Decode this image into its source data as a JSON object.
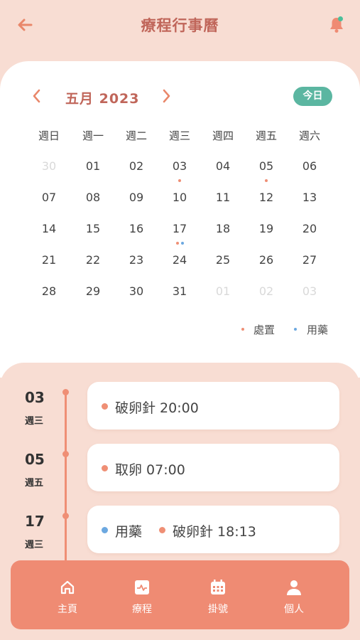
{
  "header": {
    "title": "療程行事曆",
    "back_icon": "arrow-left-icon",
    "bell_icon": "bell-icon"
  },
  "calendar": {
    "month_label": "五月 2023",
    "today_label": "今日",
    "weekdays": [
      "週日",
      "週一",
      "週二",
      "週三",
      "週四",
      "週五",
      "週六"
    ],
    "weeks": [
      [
        "30",
        "01",
        "02",
        "03",
        "04",
        "05",
        "06"
      ],
      [
        "07",
        "08",
        "09",
        "10",
        "11",
        "12",
        "13"
      ],
      [
        "14",
        "15",
        "16",
        "17",
        "18",
        "19",
        "20"
      ],
      [
        "21",
        "22",
        "23",
        "24",
        "25",
        "26",
        "27"
      ],
      [
        "28",
        "29",
        "30",
        "31",
        "01",
        "02",
        "03"
      ]
    ],
    "muted_days": [
      "0-0",
      "4-4",
      "4-5",
      "4-6"
    ],
    "markers": {
      "0-3": [
        "treatment"
      ],
      "0-5": [
        "treatment"
      ],
      "2-3": [
        "treatment",
        "medication"
      ]
    },
    "legend": {
      "treatment": "處置",
      "medication": "用藥"
    },
    "colors": {
      "treatment": "#ef8f75",
      "medication": "#6ca8e0"
    }
  },
  "events": [
    {
      "date": "03",
      "weekday": "週三",
      "items": [
        {
          "type": "treatment",
          "text": "破卵針 20:00"
        }
      ]
    },
    {
      "date": "05",
      "weekday": "週五",
      "items": [
        {
          "type": "treatment",
          "text": "取卵 07:00"
        }
      ]
    },
    {
      "date": "17",
      "weekday": "週三",
      "items": [
        {
          "type": "medication",
          "text": "用藥"
        },
        {
          "type": "treatment",
          "text": "破卵針 18:13"
        }
      ]
    }
  ],
  "nav": {
    "items": [
      {
        "label": "主頁",
        "icon": "home-icon"
      },
      {
        "label": "療程",
        "icon": "activity-icon"
      },
      {
        "label": "掛號",
        "icon": "calendar-icon"
      },
      {
        "label": "個人",
        "icon": "user-icon"
      }
    ]
  }
}
